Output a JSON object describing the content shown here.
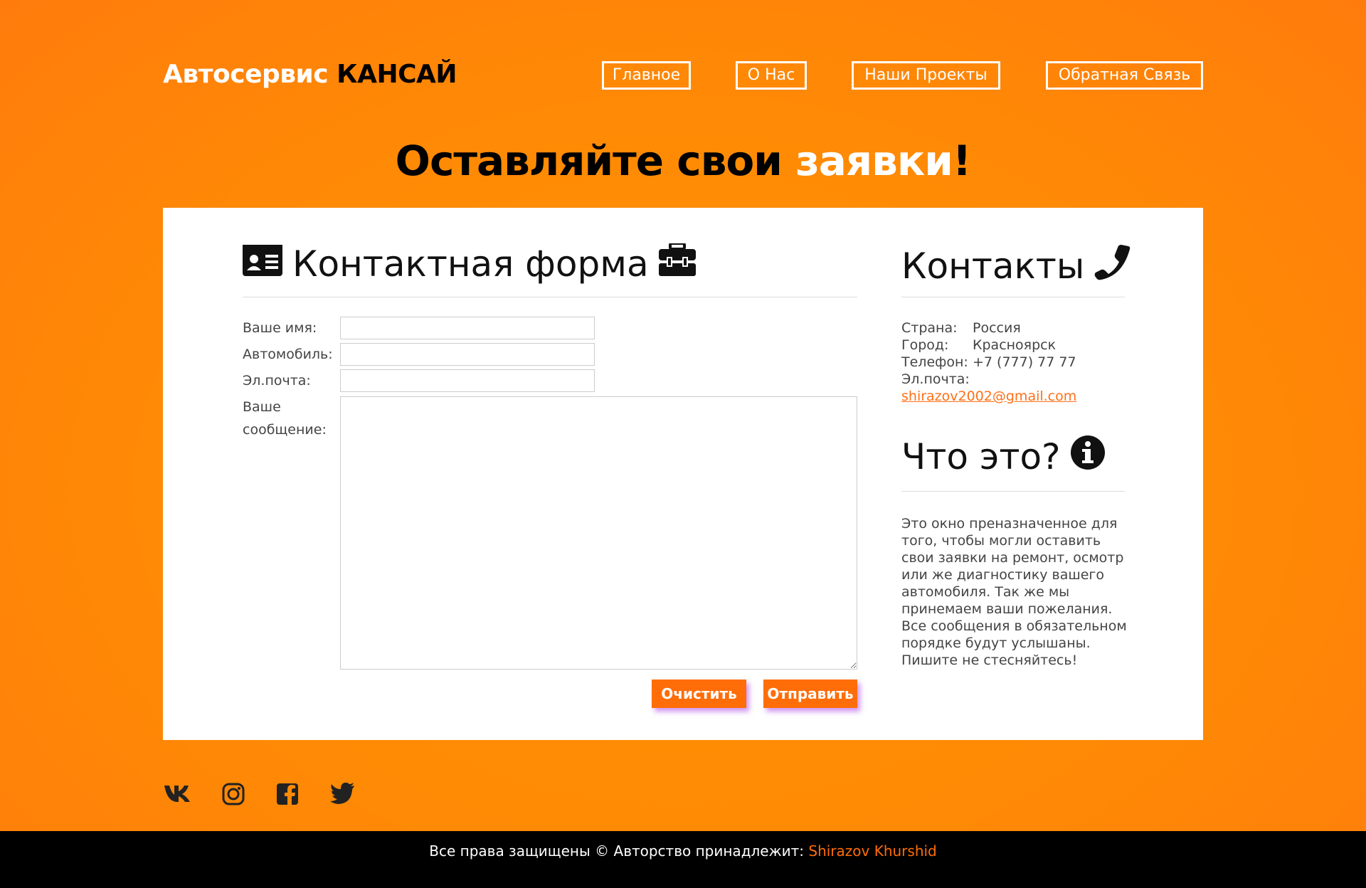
{
  "header": {
    "logo_main": "Автосервис",
    "logo_accent": "КАНСАЙ",
    "nav": [
      {
        "label": "Главное"
      },
      {
        "label": "О Нас"
      },
      {
        "label": "Наши Проекты"
      },
      {
        "label": "Обратная Связь"
      }
    ]
  },
  "hero": {
    "title_main": "Оставляйте свои ",
    "title_accent": "заявки",
    "title_end": "!"
  },
  "form": {
    "title": "Контактная форма",
    "name_label": "Ваше имя:",
    "car_label": "Автомобиль:",
    "email_label": "Эл.почта:",
    "message_label": "Ваше сообщение:",
    "name_value": "",
    "car_value": "",
    "email_value": "",
    "message_value": "",
    "clear_label": "Очистить",
    "submit_label": "Отправить"
  },
  "contacts": {
    "title": "Контакты",
    "country_key": "Страна:",
    "country_value": "Россия",
    "city_key": "Город:",
    "city_value": "Красноярск",
    "phone_key": "Телефон:",
    "phone_value": "+7 (777) 77 77",
    "email_key": "Эл.почта:",
    "email_value": "shirazov2002@gmail.com"
  },
  "about": {
    "title": "Что это?",
    "text": "Это окно преназначенное для того, чтобы могли оставить свои заявки на ремонт, осмотр или же диагностику вашего автомобиля. Так же мы принемаем ваши пожелания. Все сообщения в обязательном порядке будут услышаны. Пишите не стесняйтесь!"
  },
  "social": [
    "vk-icon",
    "instagram-icon",
    "facebook-icon",
    "twitter-icon"
  ],
  "footer": {
    "text": "Все права защищены © Авторство принадлежит: ",
    "author": "Shirazov Khurshid"
  },
  "colors": {
    "background": "#ff8a05",
    "accent": "#ff6d08",
    "footer": "#000000"
  }
}
